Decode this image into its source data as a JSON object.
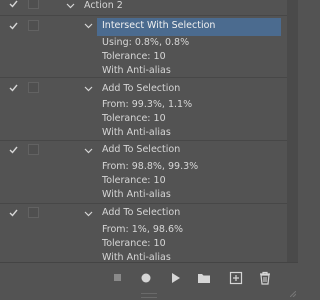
{
  "action": {
    "name": "Action 2"
  },
  "steps": [
    {
      "label": "Intersect With Selection",
      "selected": true,
      "details": [
        "Using: 0.8%, 0.8%",
        "Tolerance: 10",
        "With Anti-alias"
      ]
    },
    {
      "label": "Add To Selection",
      "selected": false,
      "details": [
        "From: 99.3%, 1.1%",
        "Tolerance: 10",
        "With Anti-alias"
      ]
    },
    {
      "label": "Add To Selection",
      "selected": false,
      "details": [
        "From: 98.8%, 99.3%",
        "Tolerance: 10",
        "With Anti-alias"
      ]
    },
    {
      "label": "Add To Selection",
      "selected": false,
      "details": [
        "From: 1%, 98.6%",
        "Tolerance: 10",
        "With Anti-alias"
      ]
    }
  ],
  "toolbar": {
    "buttons": [
      "stop-icon",
      "record-icon",
      "play-icon",
      "folder-icon",
      "new-action-icon",
      "trash-icon"
    ]
  },
  "colors": {
    "panel": "#535353",
    "selection": "#4b6b8f",
    "text": "#d6d6d6"
  }
}
